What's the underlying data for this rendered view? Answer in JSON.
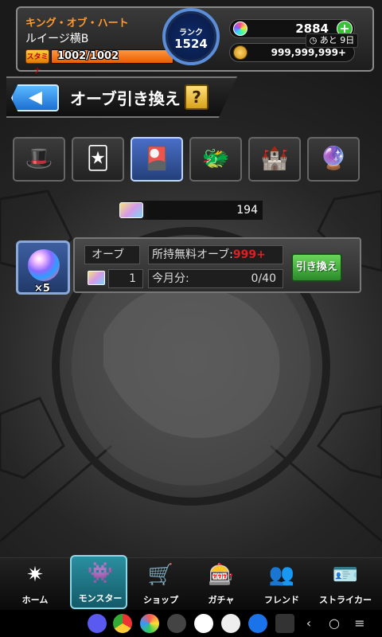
{
  "header": {
    "player_title": "キング・オブ・ハート",
    "player_name": "ルイージ横B",
    "stamina_badge": "スタミナ",
    "stamina_text": "1002/1002",
    "stamina_ratio": 1.0,
    "rank_label": "ランク",
    "rank_value": "1524",
    "orb_count": "2884",
    "plus_label": "+",
    "coin_count": "999,999,999+"
  },
  "page": {
    "back_label": "◀",
    "title": "オーブ引き換え",
    "help_label": "?"
  },
  "tabs": {
    "items": [
      {
        "icon": "top-hat-clover-icon",
        "glyph": "🎩"
      },
      {
        "icon": "card-flower-icon",
        "glyph": "🃏"
      },
      {
        "icon": "rainbow-card-icon",
        "glyph": "🎴",
        "active": true
      },
      {
        "icon": "dragon-character-icon",
        "glyph": "🐲"
      },
      {
        "icon": "treasure-box-icon",
        "glyph": "🏰"
      },
      {
        "icon": "orb-event-icon",
        "glyph": "🔮"
      }
    ],
    "badge": "◷ あと 9日"
  },
  "card_bar": {
    "count": "194"
  },
  "exchange": {
    "orb_label": "オーブ",
    "orb_multiplier": "×5",
    "card_cost": "1",
    "free_orb_label": "所持無料オーブ:",
    "free_orb_value": "999+",
    "month_label": "今月分:",
    "month_value": "0/40",
    "button_label": "引き換え"
  },
  "bottom_nav": [
    {
      "label": "ホーム",
      "icon": "home-icon",
      "glyph": "✷"
    },
    {
      "label": "モンスター",
      "icon": "monster-icon",
      "glyph": "👾",
      "active": true
    },
    {
      "label": "ショップ",
      "icon": "shop-cart-icon",
      "glyph": "🛒"
    },
    {
      "label": "ガチャ",
      "icon": "gacha-icon",
      "glyph": "🎰"
    },
    {
      "label": "フレンド",
      "icon": "friend-icon",
      "glyph": "👥"
    },
    {
      "label": "ストライカー",
      "icon": "striker-icon",
      "glyph": "🪪"
    }
  ],
  "system_nav": {
    "back": "‹",
    "home": "○",
    "recents": "≡"
  },
  "colors": {
    "accent_orange": "#ff9a2e",
    "free_orb_red": "#e02020",
    "exchange_green": "#3aa53a",
    "active_tab_blue": "#4a6ec8"
  }
}
